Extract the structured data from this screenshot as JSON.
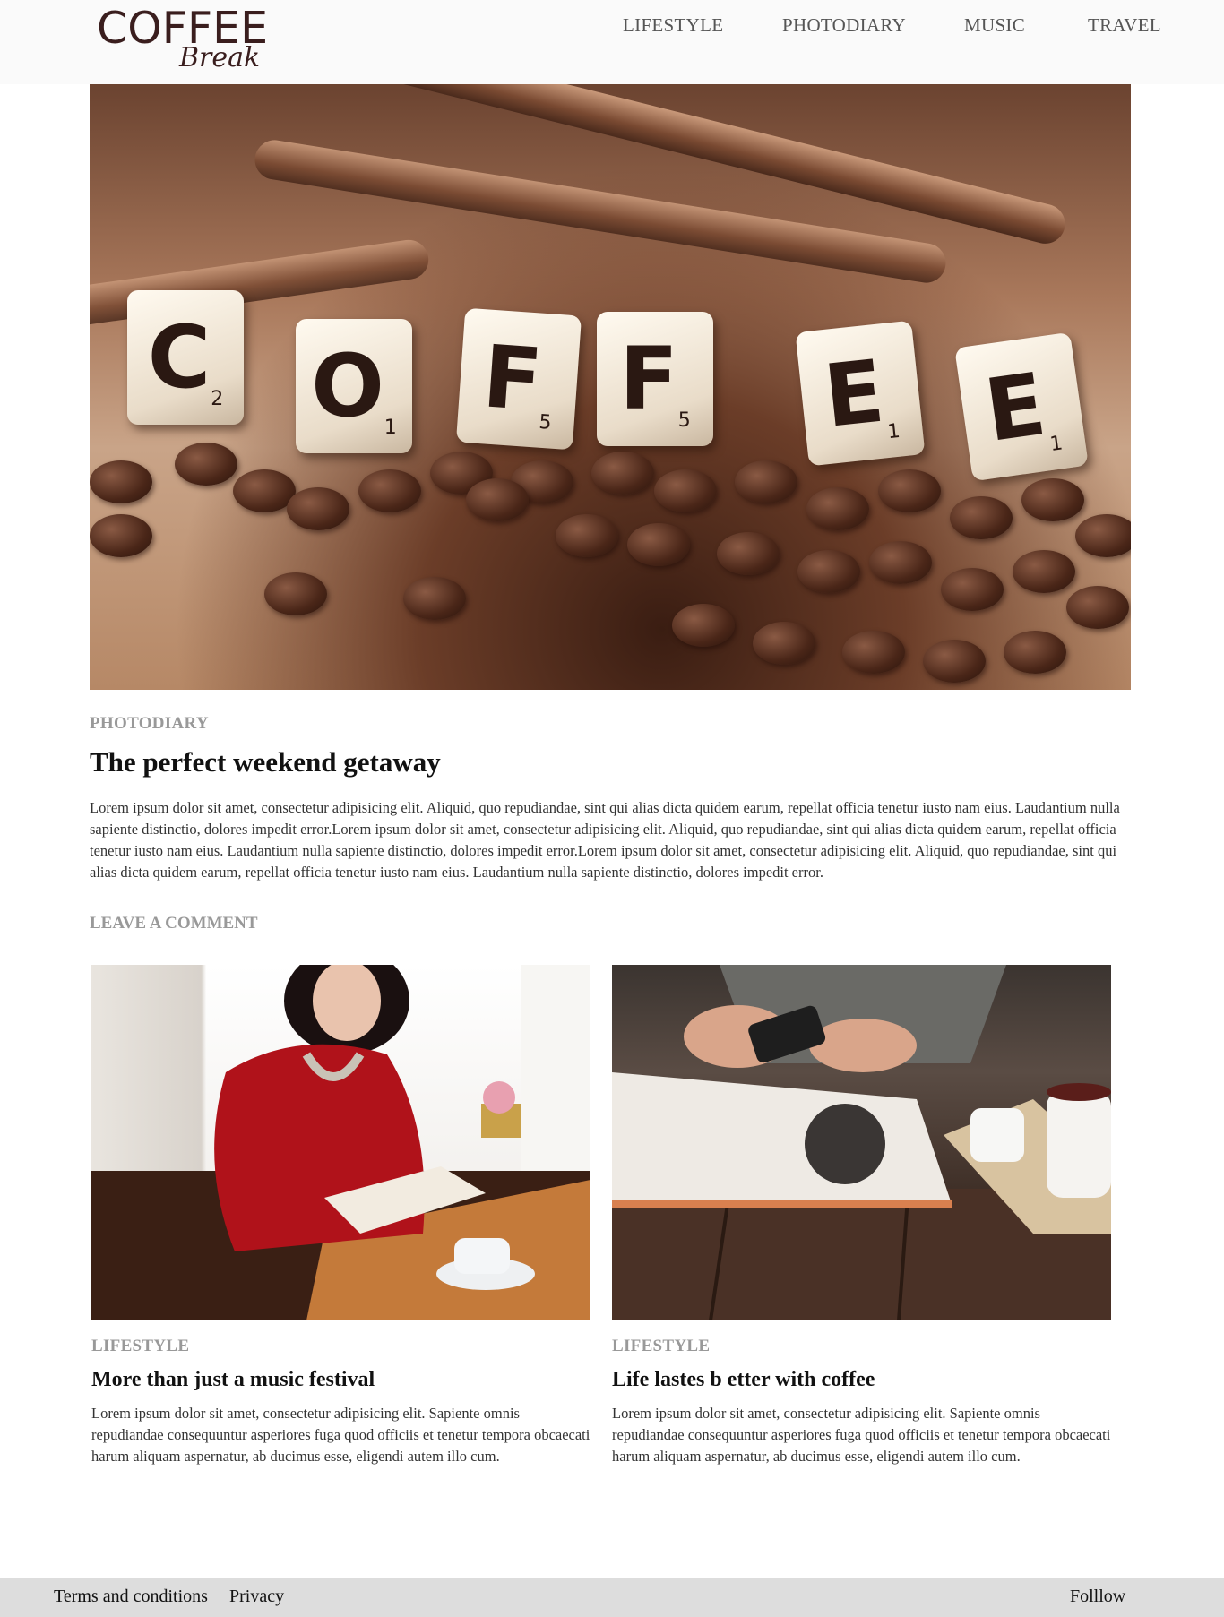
{
  "header": {
    "logo_main": "COFFEE",
    "logo_sub": "Break",
    "nav": [
      "LIFESTYLE",
      "PHOTODIARY",
      "MUSIC",
      "TRAVEL"
    ]
  },
  "hero": {
    "tiles": [
      {
        "letter": "C",
        "score": "2"
      },
      {
        "letter": "O",
        "score": "1"
      },
      {
        "letter": "F",
        "score": "5"
      },
      {
        "letter": "F",
        "score": "5"
      },
      {
        "letter": "E",
        "score": "1"
      },
      {
        "letter": "E",
        "score": "1"
      }
    ]
  },
  "article": {
    "category": "PHOTODIARY",
    "title": "The perfect weekend getaway",
    "body": "Lorem ipsum dolor sit amet, consectetur adipisicing elit. Aliquid, quo repudiandae, sint qui alias dicta quidem earum, repellat officia tenetur iusto nam eius. Laudantium nulla sapiente distinctio, dolores impedit error.Lorem ipsum dolor sit amet, consectetur adipisicing elit. Aliquid, quo repudiandae, sint qui alias dicta quidem earum, repellat officia tenetur iusto nam eius. Laudantium nulla sapiente distinctio, dolores impedit error.Lorem ipsum dolor sit amet, consectetur adipisicing elit. Aliquid, quo repudiandae, sint qui alias dicta quidem earum, repellat officia tenetur iusto nam eius. Laudantium nulla sapiente distinctio, dolores impedit error.",
    "comment_link": "LEAVE A COMMENT"
  },
  "cards": [
    {
      "category": "LIFESTYLE",
      "title": "More than just a music festival",
      "body": "Lorem ipsum dolor sit amet, consectetur adipisicing elit. Sapiente omnis repudiandae consequuntur asperiores fuga quod officiis et tenetur tempora obcaecati harum aliquam aspernatur, ab ducimus esse, eligendi autem illo cum."
    },
    {
      "category": "LIFESTYLE",
      "title": "Life lastes b etter with coffee",
      "body": "Lorem ipsum dolor sit amet, consectetur adipisicing elit. Sapiente omnis repudiandae consequuntur asperiores fuga quod officiis et tenetur tempora obcaecati harum aliquam aspernatur, ab ducimus esse, eligendi autem illo cum."
    }
  ],
  "footer": {
    "terms": "Terms and conditions",
    "privacy": "Privacy",
    "follow": "Folllow"
  },
  "colors": {
    "header_bg": "#fafafa",
    "footer_bg": "#dddddd",
    "category_gray": "#999999",
    "logo_brown": "#3a1e1e"
  }
}
